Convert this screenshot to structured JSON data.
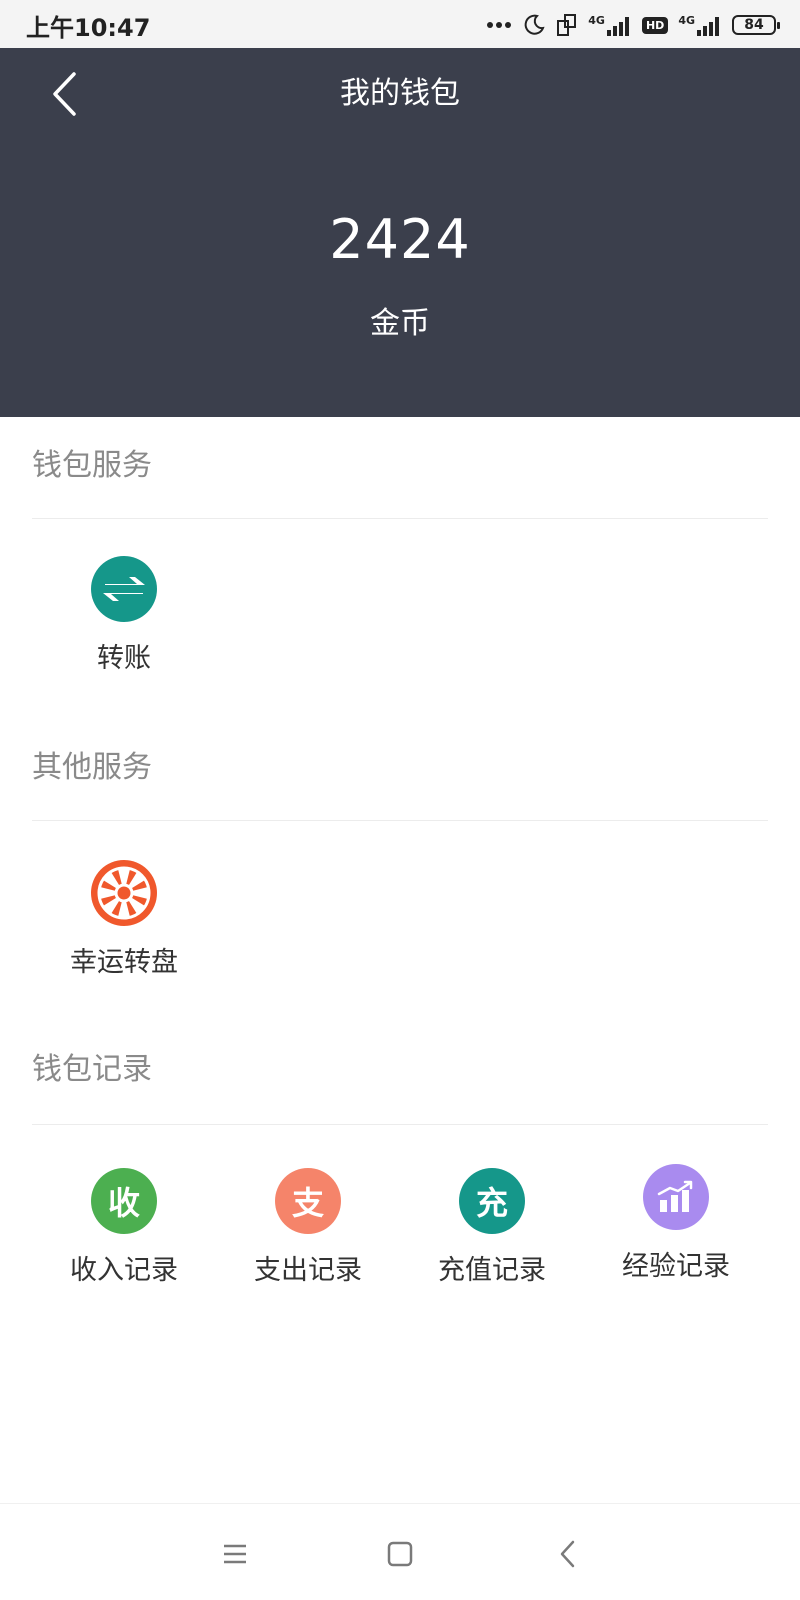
{
  "status_bar": {
    "time": "上午10:47",
    "signal_label": "4G",
    "hd_label": "HD",
    "battery_level": "84"
  },
  "header": {
    "title": "我的钱包",
    "balance": "2424",
    "balance_unit": "金币",
    "background_color": "#3b3f4c"
  },
  "sections": [
    {
      "title": "钱包服务",
      "items": [
        {
          "label": "转账",
          "icon": "transfer-icon",
          "color": "#15978a"
        }
      ]
    },
    {
      "title": "其他服务",
      "items": [
        {
          "label": "幸运转盘",
          "icon": "lucky-wheel-icon",
          "color": "#f0582c"
        }
      ]
    },
    {
      "title": "钱包记录",
      "items": [
        {
          "label": "收入记录",
          "icon": "income-icon",
          "glyph": "收",
          "color": "#4caf50"
        },
        {
          "label": "支出记录",
          "icon": "expense-icon",
          "glyph": "支",
          "color": "#f5846a"
        },
        {
          "label": "充值记录",
          "icon": "recharge-icon",
          "glyph": "充",
          "color": "#15978a"
        },
        {
          "label": "经验记录",
          "icon": "experience-chart-icon",
          "color": "#a98bef"
        }
      ]
    }
  ]
}
